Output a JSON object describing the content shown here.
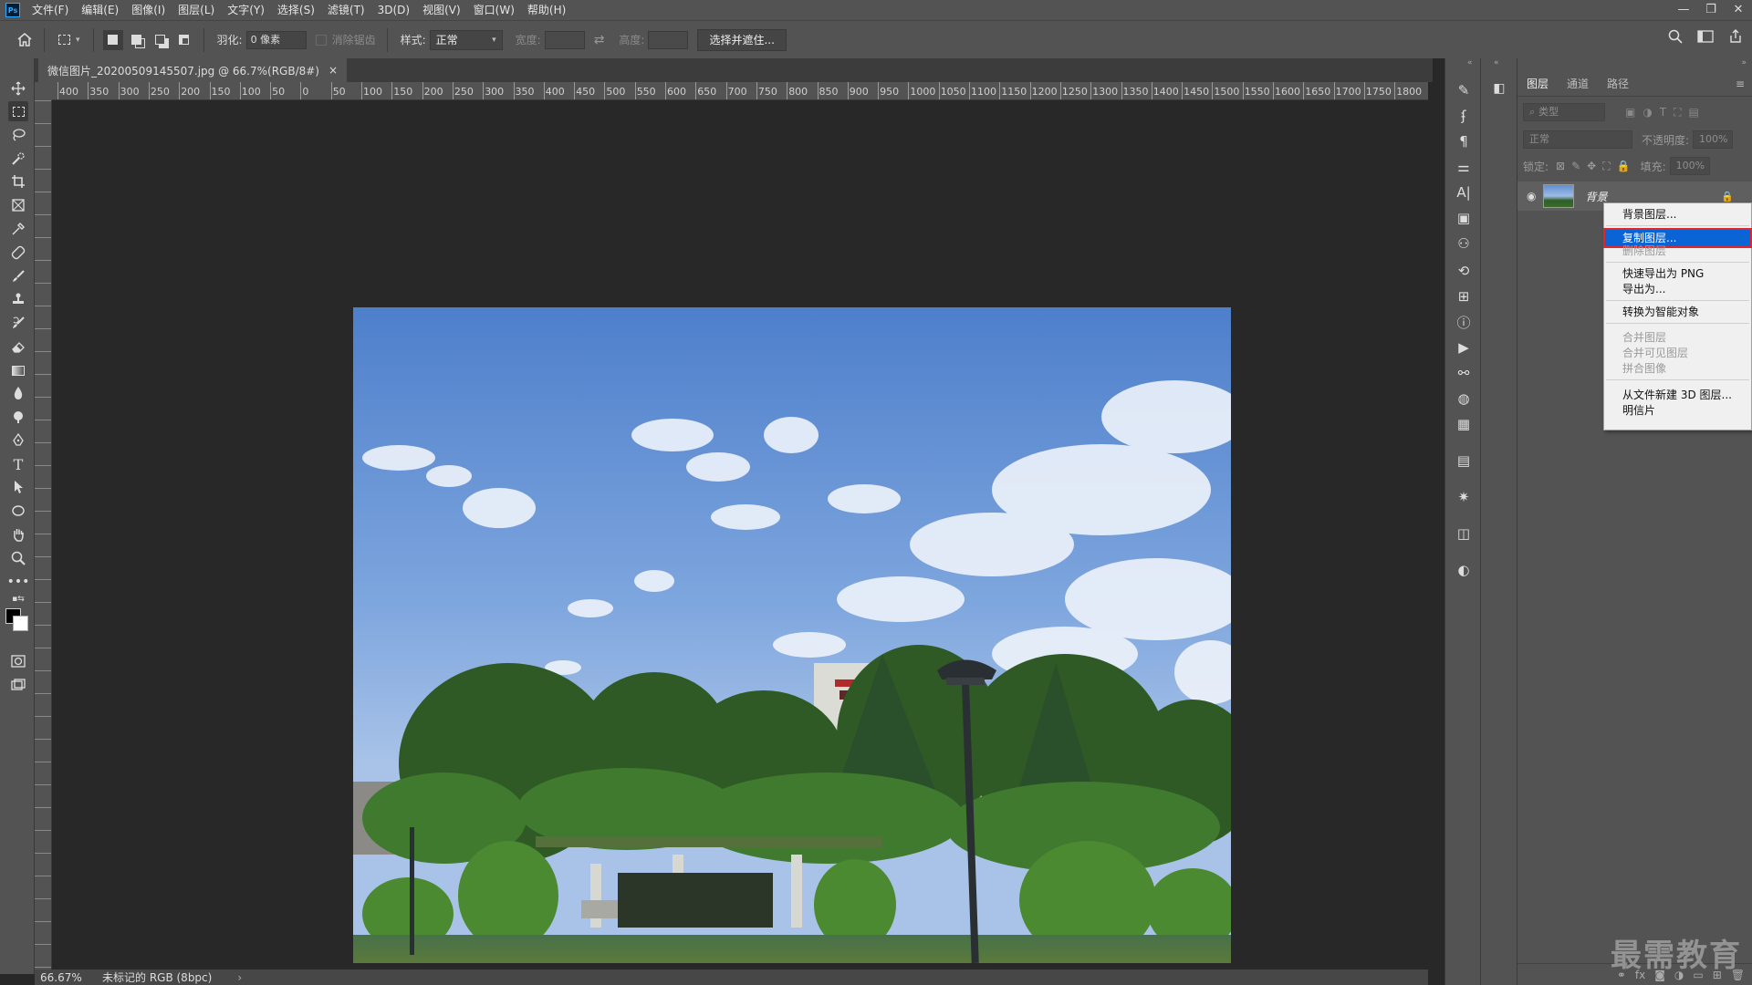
{
  "menubar": {
    "logo": "Ps",
    "items": [
      "文件(F)",
      "编辑(E)",
      "图像(I)",
      "图层(L)",
      "文字(Y)",
      "选择(S)",
      "滤镜(T)",
      "3D(D)",
      "视图(V)",
      "窗口(W)",
      "帮助(H)"
    ],
    "window_controls": [
      "—",
      "❐",
      "✕"
    ]
  },
  "options": {
    "feather_label": "羽化:",
    "feather_value": "0 像素",
    "antialias_label": "消除锯齿",
    "style_label": "样式:",
    "style_value": "正常",
    "width_label": "宽度:",
    "height_label": "高度:",
    "select_mask_button": "选择并遮住..."
  },
  "document": {
    "tab_title": "微信图片_20200509145507.jpg @ 66.7%(RGB/8#)",
    "tab_close": "×",
    "zoom": "66.67%",
    "color_profile": "未标记的 RGB (8bpc)",
    "status_arrow": "›"
  },
  "ruler": {
    "h_labels": [
      "400",
      "350",
      "300",
      "250",
      "200",
      "150",
      "100",
      "50",
      "0",
      "50",
      "100",
      "150",
      "200",
      "250",
      "300",
      "350",
      "400",
      "450",
      "500",
      "550",
      "600",
      "650",
      "700",
      "750",
      "800",
      "850",
      "900",
      "950",
      "1000",
      "1050",
      "1100",
      "1150",
      "1200",
      "1250",
      "1300",
      "1350",
      "1400",
      "1450",
      "1500",
      "1550",
      "1600",
      "1650",
      "1700",
      "1750",
      "1800"
    ]
  },
  "layers_panel": {
    "tabs": [
      "图层",
      "通道",
      "路径"
    ],
    "filter_placeholder": "类型",
    "blend_mode": "正常",
    "opacity_label": "不透明度:",
    "opacity_value": "100%",
    "lock_label": "锁定:",
    "fill_label": "填充:",
    "fill_value": "100%",
    "layer_name": "背景"
  },
  "context_menu": {
    "items": [
      {
        "label": "背景图层...",
        "disabled": false
      },
      {
        "label": "复制图层...",
        "disabled": false,
        "highlighted": true
      },
      {
        "label": "删除图层",
        "disabled": true
      },
      {
        "label": "快速导出为 PNG",
        "disabled": false
      },
      {
        "label": "导出为...",
        "disabled": false
      },
      {
        "label": "转换为智能对象",
        "disabled": false
      },
      {
        "label": "合并图层",
        "disabled": true
      },
      {
        "label": "合并可见图层",
        "disabled": true
      },
      {
        "label": "拼合图像",
        "disabled": true
      },
      {
        "label": "从文件新建 3D 图层...",
        "disabled": false
      },
      {
        "label": "明信片",
        "disabled": false
      }
    ]
  },
  "watermark": "最需教育",
  "colors": {
    "panel_bg": "#535353",
    "canvas_bg": "#282828",
    "menu_highlight": "#0a64d6",
    "highlight_border": "#e0262b"
  }
}
